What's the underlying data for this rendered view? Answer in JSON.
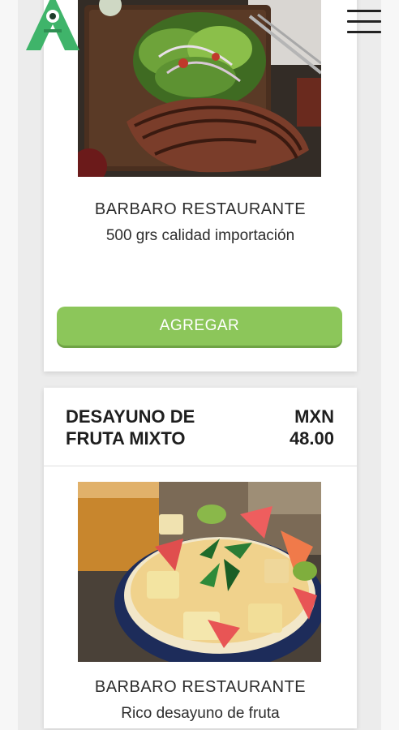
{
  "header": {
    "logo_icon": "green-a-logo-icon",
    "menu_icon": "hamburger-menu-icon"
  },
  "products": [
    {
      "restaurant": "BARBARO RESTAURANTE",
      "description": "500 grs calidad importación",
      "add_label": "AGREGAR",
      "image": "grilled-steak-salad-image"
    },
    {
      "name": "DESAYUNO DE FRUTA MIXTO",
      "currency": "MXN",
      "price": "48.00",
      "restaurant": "BARBARO RESTAURANTE",
      "description": "Rico desayuno de fruta",
      "image": "fruit-bowl-image"
    }
  ],
  "colors": {
    "accent": "#8cc65a",
    "logo": "#3fb46a"
  }
}
